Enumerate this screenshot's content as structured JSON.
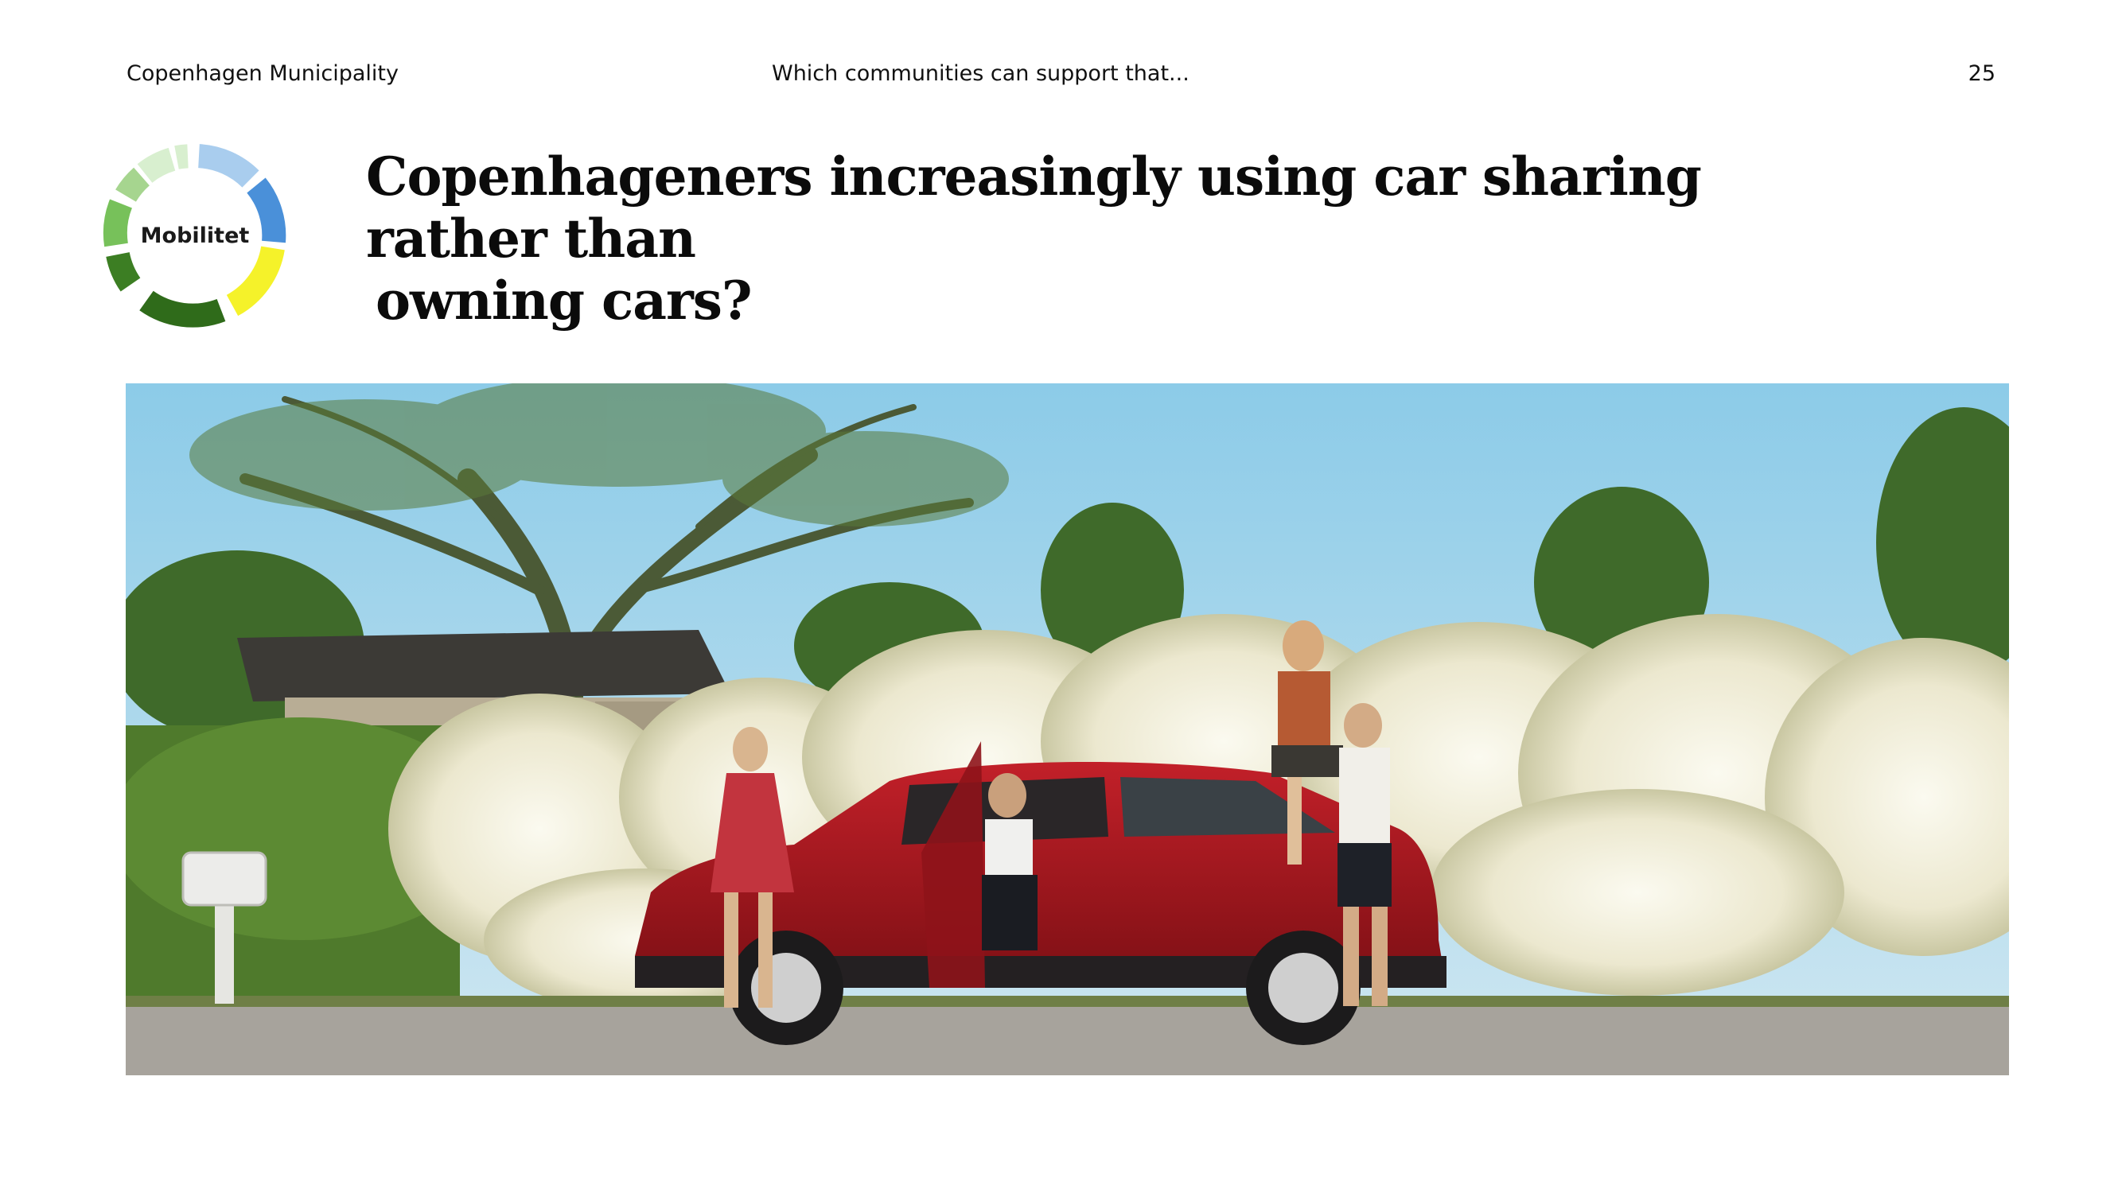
{
  "header": {
    "left": "Copenhagen Municipality",
    "center": "Which communities can support that...",
    "page_number": "25"
  },
  "title": {
    "line1": "Copenhageners increasingly using car sharing rather than",
    "line2": "owning cars?"
  },
  "badge": {
    "label": "Mobilitet",
    "ring_colors": [
      "#d8efcf",
      "#a6d58f",
      "#77c15a",
      "#a9cdee",
      "#4a90d9",
      "#f5f22a",
      "#2f6b1a",
      "#3c7e23"
    ]
  },
  "photo": {
    "subject": "photo-car-sharing-friends",
    "colors": {
      "sky": "#9fd0ea",
      "car": "#a3161c",
      "flowers": "#f4f1e2",
      "hedge": "#4f7a2c",
      "road": "#a7a39c"
    }
  }
}
